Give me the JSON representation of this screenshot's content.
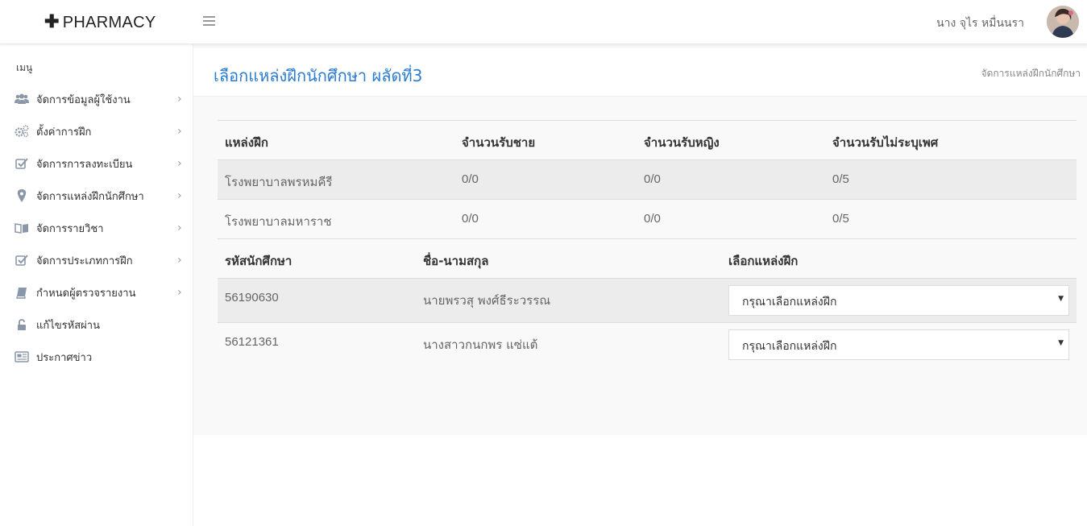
{
  "header": {
    "brand": "PHARMACY",
    "brand_icon": "plus-icon",
    "user_name": "นาง จุไร หมื่นนรา"
  },
  "sidebar": {
    "heading": "เมนู",
    "items": [
      {
        "label": "จัดการข้อมูลผู้ใช้งาน",
        "icon": "users-icon",
        "has_submenu": true
      },
      {
        "label": "ตั้งค่าการฝึก",
        "icon": "cogs-icon",
        "has_submenu": true
      },
      {
        "label": "จัดการการลงทะเบียน",
        "icon": "check-square-icon",
        "has_submenu": true
      },
      {
        "label": "จัดการแหล่งฝึกนักศึกษา",
        "icon": "map-marker-icon",
        "has_submenu": true
      },
      {
        "label": "จัดการรายวิชา",
        "icon": "book-open-icon",
        "has_submenu": true
      },
      {
        "label": "จัดการประเภทการฝึก",
        "icon": "check-square-icon",
        "has_submenu": true
      },
      {
        "label": "กำหนดผู้ตรวจรายงาน",
        "icon": "book-icon",
        "has_submenu": true
      },
      {
        "label": "แก้ไขรหัสผ่าน",
        "icon": "unlock-icon",
        "has_submenu": false
      },
      {
        "label": "ประกาศข่าว",
        "icon": "newspaper-icon",
        "has_submenu": false
      }
    ]
  },
  "page": {
    "title": "เลือกแหล่งฝึกนักศึกษา ผลัดที่3",
    "breadcrumb": "จัดการแหล่งฝึกนักศึกษา"
  },
  "sites_table": {
    "headers": [
      "แหล่งฝึก",
      "จำนวนรับชาย",
      "จำนวนรับหญิง",
      "จำนวนรับไม่ระบุเพศ"
    ],
    "rows": [
      [
        "โรงพยาบาลพรหมคีรี",
        "0/0",
        "0/0",
        "0/5"
      ],
      [
        "โรงพยาบาลมหาราช",
        "0/0",
        "0/0",
        "0/5"
      ]
    ]
  },
  "students_table": {
    "headers": [
      "รหัสนักศึกษา",
      "ชื่อ-นามสกุล",
      "เลือกแหล่งฝึก"
    ],
    "rows": [
      {
        "id": "56190630",
        "name": "นายพรวสุ พงศ์ธีระวรรณ",
        "select_value": "กรุณาเลือกแหล่งฝึก"
      },
      {
        "id": "56121361",
        "name": "นางสาวกนกพร แซ่แต้",
        "select_value": "กรุณาเลือกแหล่งฝึก"
      }
    ]
  },
  "colors": {
    "accent": "#2b7bd1",
    "row_shade": "#ececec",
    "content_bg": "#f9f9f9"
  }
}
